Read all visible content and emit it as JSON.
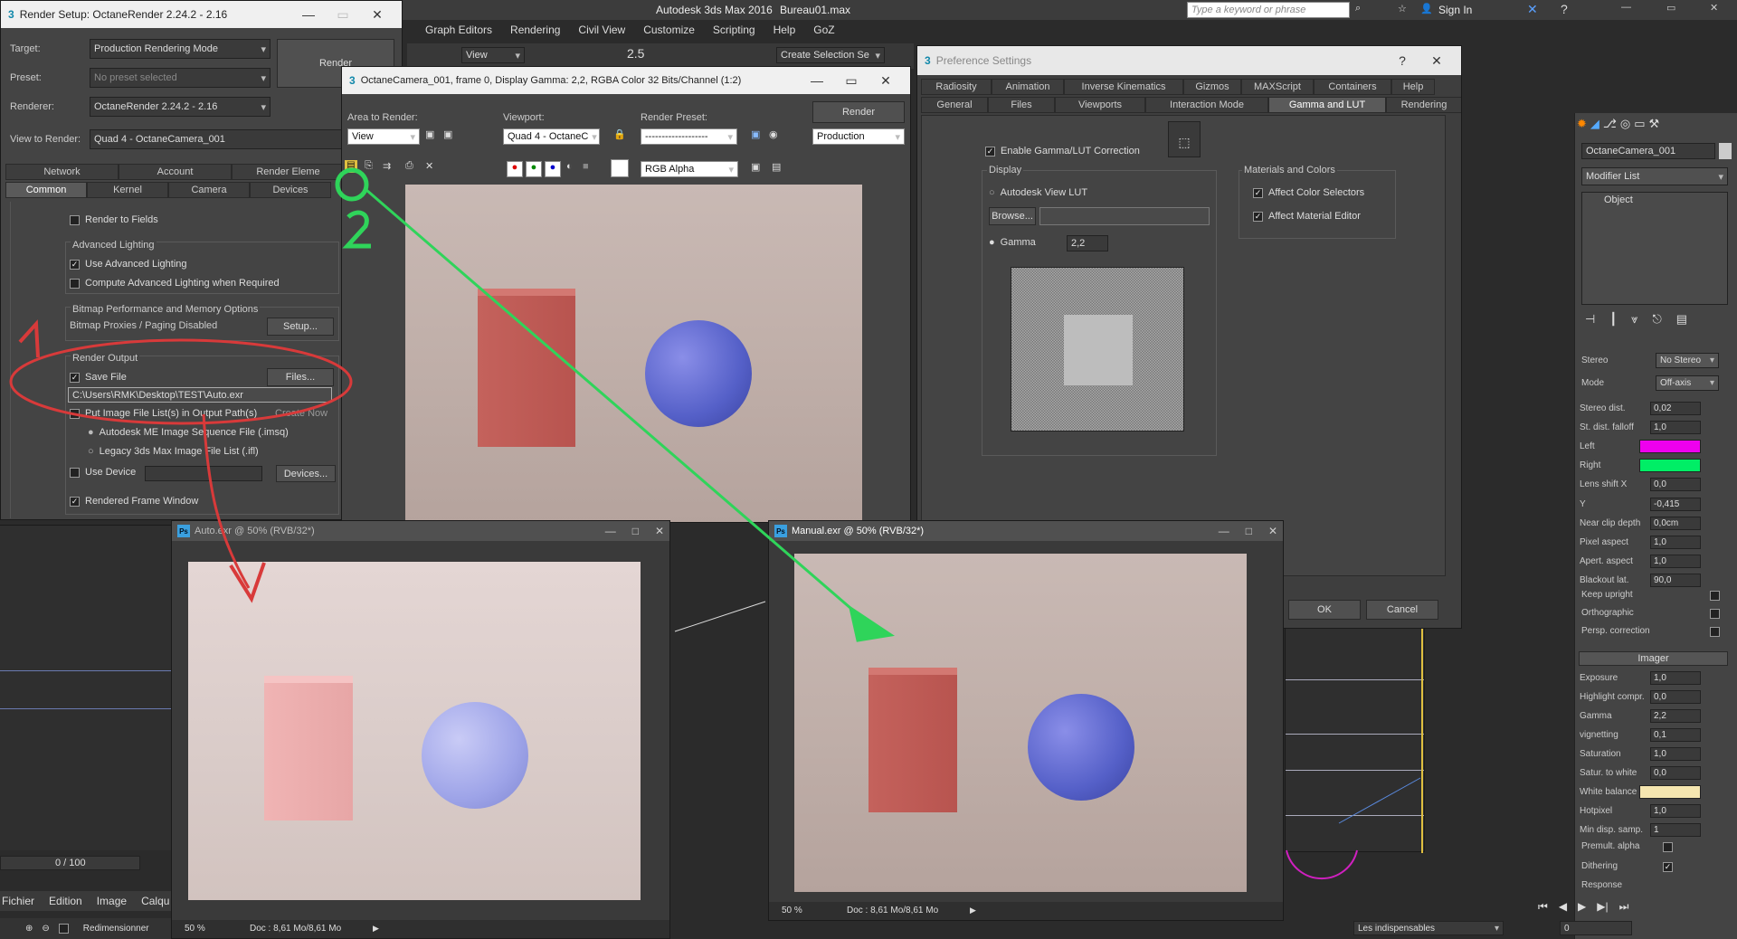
{
  "max": {
    "title": "Autodesk 3ds Max 2016",
    "file": "Bureau01.max",
    "search_placeholder": "Type a keyword or phrase",
    "sign_in": "Sign In",
    "menu": [
      "Graph Editors",
      "Rendering",
      "Civil View",
      "Customize",
      "Scripting",
      "Help",
      "GoZ"
    ],
    "toolbar_view": "View",
    "toolbar_spin": "2.5",
    "create_selection": "Create Selection Se",
    "timeline": "0 / 100",
    "bottom_preset": "Les indispensables",
    "frame_field": "0"
  },
  "render_setup": {
    "title": "Render Setup: OctaneRender 2.24.2 - 2.16",
    "target_label": "Target:",
    "target_value": "Production Rendering Mode",
    "preset_label": "Preset:",
    "preset_value": "No preset selected",
    "renderer_label": "Renderer:",
    "renderer_value": "OctaneRender 2.24.2 - 2.16",
    "view_label": "View to Render:",
    "view_value": "Quad 4 - OctaneCamera_001",
    "render_btn": "Render",
    "tabs_row1": [
      "Network",
      "Account",
      "Render Eleme"
    ],
    "tabs_row2": [
      "Common",
      "Kernel",
      "Camera",
      "Devices"
    ],
    "render_to_fields": "Render to Fields",
    "adv_lighting": "Advanced Lighting",
    "use_adv": "Use Advanced Lighting",
    "compute_adv": "Compute Advanced Lighting when Required",
    "bitmap_group": "Bitmap Performance and Memory Options",
    "bitmap_proxies": "Bitmap Proxies / Paging Disabled",
    "setup_btn": "Setup...",
    "render_output": "Render Output",
    "save_file": "Save File",
    "files_btn": "Files...",
    "output_path": "C:\\Users\\RMK\\Desktop\\TEST\\Auto.exr",
    "put_image": "Put Image File List(s) in Output Path(s)",
    "create_now": "Create Now",
    "ime_seq": "Autodesk ME Image Sequence File (.imsq)",
    "legacy": "Legacy 3ds Max Image File List (.ifl)",
    "use_device": "Use Device",
    "devices_btn": "Devices...",
    "rendered_frame": "Rendered Frame Window"
  },
  "frame_window": {
    "title": "OctaneCamera_001, frame 0, Display Gamma: 2,2, RGBA Color 32 Bits/Channel (1:2)",
    "area_label": "Area to Render:",
    "area_value": "View",
    "viewport_label": "Viewport:",
    "viewport_value": "Quad 4 - OctaneC",
    "preset_label": "Render Preset:",
    "preset_value": "-------------------",
    "render_btn": "Render",
    "production": "Production",
    "channel": "RGB Alpha"
  },
  "prefs": {
    "title": "Preference Settings",
    "help": "?",
    "tabs_row1": [
      "Radiosity",
      "Animation",
      "Inverse Kinematics",
      "Gizmos",
      "MAXScript",
      "Containers",
      "Help"
    ],
    "tabs_row2": [
      "General",
      "Files",
      "Viewports",
      "Interaction Mode",
      "Gamma and LUT",
      "Rendering"
    ],
    "enable": "Enable Gamma/LUT Correction",
    "display": "Display",
    "view_lut": "Autodesk View LUT",
    "browse": "Browse...",
    "gamma": "Gamma",
    "gamma_value": "2,2",
    "materials": "Materials and Colors",
    "affect_color": "Affect Color Selectors",
    "affect_mat": "Affect Material Editor",
    "ok": "OK",
    "cancel": "Cancel"
  },
  "ps_auto": {
    "title": "Auto.exr @ 50% (RVB/32*)",
    "zoom": "50 %",
    "doc": "Doc : 8,61 Mo/8,61 Mo"
  },
  "ps_manual": {
    "title": "Manual.exr @ 50% (RVB/32*)",
    "zoom": "50 %",
    "doc": "Doc : 8,61 Mo/8,61 Mo"
  },
  "ps_app": {
    "menu": [
      "Fichier",
      "Edition",
      "Image",
      "Calqu"
    ],
    "resize": "Redimensionner"
  },
  "right_panel": {
    "object_name": "OctaneCamera_001",
    "modifier_list": "Modifier List",
    "stack_item": "Object",
    "stereo_label": "Stereo",
    "stereo_value": "No Stereo",
    "mode_label": "Mode",
    "mode_value": "Off-axis",
    "rows": [
      {
        "n": "Stereo dist.",
        "v": "0,02"
      },
      {
        "n": "St. dist. falloff",
        "v": "1,0"
      },
      {
        "n": "Left",
        "v": ""
      },
      {
        "n": "Right",
        "v": ""
      },
      {
        "n": "Lens shift   X",
        "v": "0,0"
      },
      {
        "n": "Y",
        "v": "-0,415"
      },
      {
        "n": "Near clip depth",
        "v": "0,0cm"
      },
      {
        "n": "Pixel aspect",
        "v": "1,0"
      },
      {
        "n": "Apert. aspect",
        "v": "1,0"
      },
      {
        "n": "Blackout lat.",
        "v": "90,0"
      }
    ],
    "keep_upright": "Keep upright",
    "orthographic": "Orthographic",
    "persp": "Persp. correction",
    "imager": "Imager",
    "imager_rows": [
      {
        "n": "Exposure",
        "v": "1,0"
      },
      {
        "n": "Highlight compr.",
        "v": "0,0"
      },
      {
        "n": "Gamma",
        "v": "2,2"
      },
      {
        "n": "vignetting",
        "v": "0,1"
      },
      {
        "n": "Saturation",
        "v": "1,0"
      },
      {
        "n": "Satur. to white",
        "v": "0,0"
      },
      {
        "n": "White balance",
        "v": ""
      },
      {
        "n": "Hotpixel",
        "v": "1,0"
      },
      {
        "n": "Min disp. samp.",
        "v": "1"
      }
    ],
    "premult": "Premult. alpha",
    "dithering": "Dithering",
    "response": "Response"
  },
  "annotations": {
    "one": "1",
    "two": "2"
  },
  "colors": {
    "left": "#ee00ee",
    "right": "#00ee66",
    "white_balance": "#f5e6b0",
    "red_arrow": "#d83a3a",
    "green_arrow": "#2fd45a"
  }
}
